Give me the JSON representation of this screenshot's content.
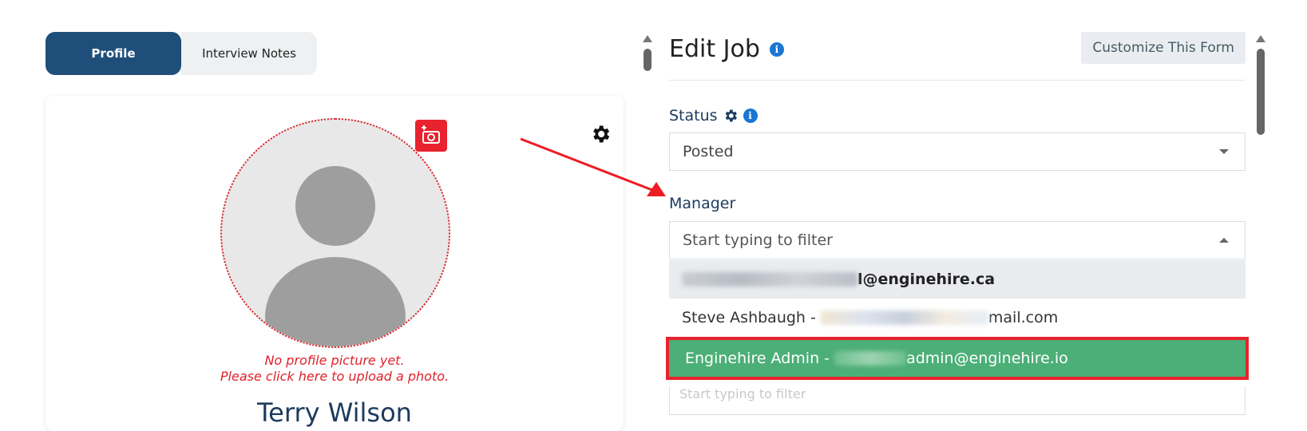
{
  "tabs": [
    {
      "label": "Profile",
      "active": true
    },
    {
      "label": "Interview Notes",
      "active": false
    }
  ],
  "profile": {
    "no_picture_line1": "No profile picture yet.",
    "no_picture_line2": "Please click here to upload a photo.",
    "name": "Terry Wilson"
  },
  "edit_job": {
    "title": "Edit Job",
    "customize_button": "Customize This Form",
    "status": {
      "label": "Status",
      "value": "Posted"
    },
    "manager": {
      "label": "Manager",
      "placeholder": "Start typing to filter",
      "options": [
        {
          "visible_text": "l@enginehire.ca",
          "state": "hovered"
        },
        {
          "prefix": "Steve Ashbaugh - ",
          "visible_suffix": "mail.com",
          "state": "normal"
        },
        {
          "prefix": "Enginehire Admin - ",
          "visible_suffix": "admin@enginehire.io",
          "state": "selected"
        }
      ],
      "filter_placeholder_below": "Start typing to filter"
    }
  },
  "colors": {
    "tab_active": "#1f4e7a",
    "accent_red": "#e8232e",
    "selected_option": "#4caf77",
    "label_navy": "#1c3a5e",
    "info_blue": "#1976d2"
  },
  "icons": [
    "camera-add-icon",
    "gear-icon",
    "info-icon",
    "chevron-down-icon",
    "chevron-up-icon",
    "annotation-arrow"
  ]
}
